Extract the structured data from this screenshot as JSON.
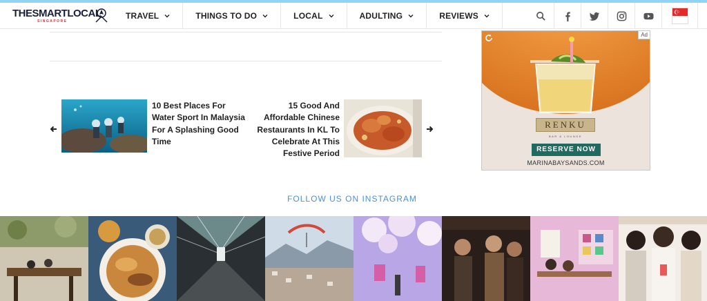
{
  "brand": {
    "name": "THESMARTLOCAL",
    "sub": "SINGAPORE"
  },
  "nav": {
    "items": [
      {
        "label": "TRAVEL"
      },
      {
        "label": "THINGS TO DO"
      },
      {
        "label": "LOCAL"
      },
      {
        "label": "ADULTING"
      },
      {
        "label": "REVIEWS"
      }
    ]
  },
  "header_icons": [
    "search-icon",
    "facebook-icon",
    "twitter-icon",
    "instagram-icon",
    "youtube-icon",
    "singapore-flag-icon"
  ],
  "related": {
    "left_title": "10 Best Places For Water Sport In Malaysia For A Splashing Good Time",
    "right_title": "15 Good And Affordable Chinese Restaurants In KL To Celebrate At This Festive Period"
  },
  "ad": {
    "badge": "Ad",
    "brand": "RENKU",
    "brand_sub": "BAR & LOUNGE",
    "cta": "RESERVE NOW",
    "domain": "MARINABAYSANDS.COM"
  },
  "instagram": {
    "heading": "FOLLOW US ON INSTAGRAM"
  },
  "colors": {
    "accent_blue": "#4a90d9",
    "ad_cta": "#1f6b62",
    "top_stripe": "#8fd3f5"
  }
}
